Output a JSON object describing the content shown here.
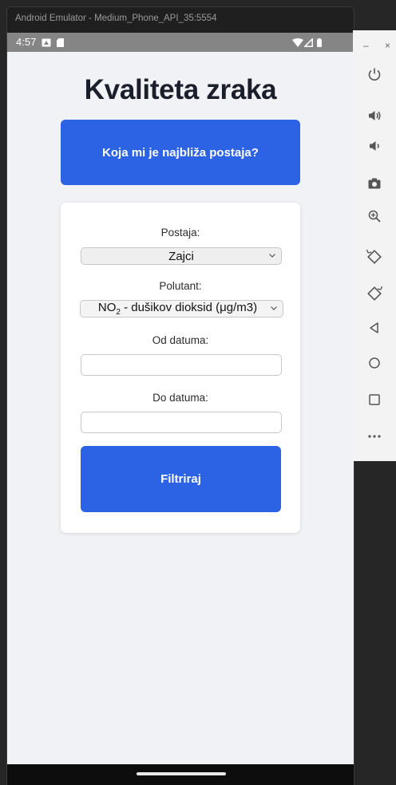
{
  "window": {
    "title": "Android Emulator - Medium_Phone_API_35:5554"
  },
  "status_bar": {
    "time": "4:57"
  },
  "app": {
    "title": "Kvaliteta zraka",
    "nearest_button": "Koja mi je najbliža postaja?",
    "form": {
      "station_label": "Postaja:",
      "station_value": "Zajci",
      "pollutant_label": "Polutant:",
      "pollutant_value_prefix": "NO",
      "pollutant_value_sub": "2",
      "pollutant_value_rest": " - dušikov dioksid (μg/m3)",
      "from_date_label": "Od datuma:",
      "from_date_value": "",
      "to_date_label": "Do datuma:",
      "to_date_value": "",
      "filter_button": "Filtriraj"
    },
    "colors": {
      "accent": "#2c63e5",
      "background": "#f1f2f5"
    }
  },
  "toolbar": {
    "minimize": "–",
    "close": "×",
    "buttons": [
      "power-icon",
      "volume-up-icon",
      "volume-down-icon",
      "camera-icon",
      "zoom-icon",
      "rotate-left-icon",
      "rotate-right-icon",
      "back-icon",
      "home-icon",
      "overview-icon",
      "more-icon"
    ]
  }
}
